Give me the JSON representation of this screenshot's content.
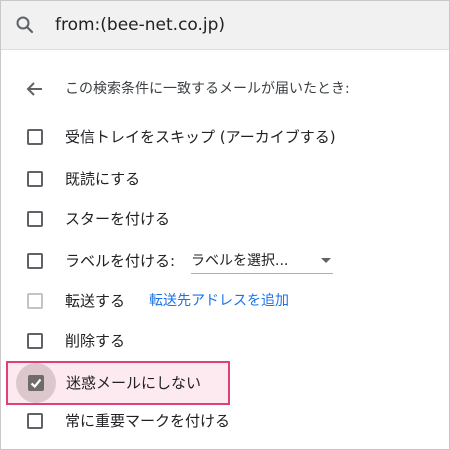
{
  "search": {
    "query": "from:(bee-net.co.jp)",
    "icon": "search-icon"
  },
  "filter": {
    "header": "この検索条件に一致するメールが届いたとき:",
    "back_icon": "arrow-back-icon",
    "options": {
      "skip_inbox": {
        "label": "受信トレイをスキップ (アーカイブする)",
        "checked": false
      },
      "mark_read": {
        "label": "既読にする",
        "checked": false
      },
      "star": {
        "label": "スターを付ける",
        "checked": false
      },
      "apply_label": {
        "label": "ラベルを付ける:",
        "dropdown_value": "ラベルを選択...",
        "checked": false
      },
      "forward": {
        "label": "転送する",
        "link": "転送先アドレスを追加",
        "checked": false,
        "disabled": true
      },
      "delete": {
        "label": "削除する",
        "checked": false
      },
      "never_spam": {
        "label": "迷惑メールにしない",
        "checked": true
      },
      "always_important": {
        "label": "常に重要マークを付ける",
        "checked": false
      }
    }
  },
  "colors": {
    "highlight_border": "#e0407a",
    "highlight_fill": "#fdeaf0",
    "link": "#1a73e8",
    "checked_box": "#6f6a6c"
  }
}
